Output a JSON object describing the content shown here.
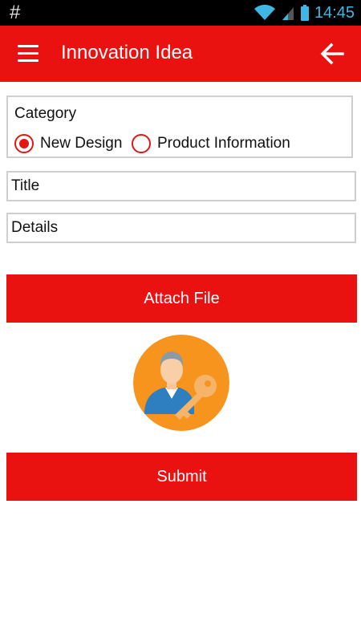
{
  "status_bar": {
    "left_symbol": "#",
    "time": "14:45",
    "icons": [
      "wifi-icon",
      "signal-icon",
      "battery-icon"
    ]
  },
  "app_bar": {
    "title": "Innovation Idea",
    "menu_icon": "menu-icon",
    "back_icon": "back-arrow-icon"
  },
  "form": {
    "category": {
      "label": "Category",
      "options": [
        "New Design",
        "Product Information"
      ],
      "selected": "New Design"
    },
    "title_placeholder": "Title",
    "details_placeholder": "Details",
    "attach_label": "Attach File",
    "submit_label": "Submit"
  },
  "colors": {
    "primary": "#ea1111",
    "status_time": "#3fb7e6",
    "avatar_bg": "#f7941d"
  }
}
